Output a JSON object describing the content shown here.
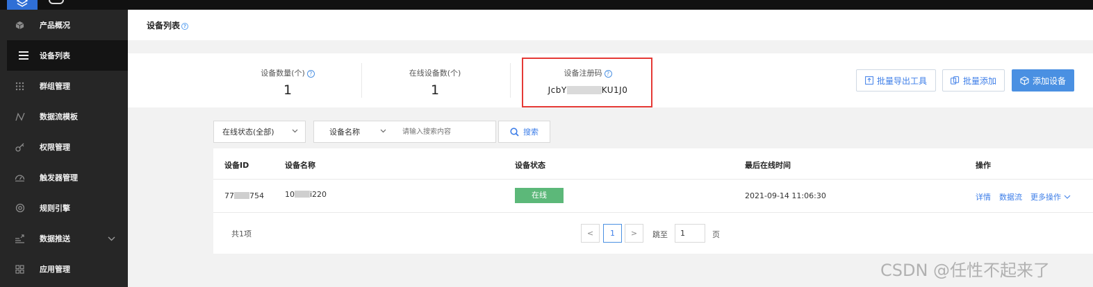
{
  "sidebar": {
    "items": [
      {
        "label": "产品概况",
        "icon": "cube-icon"
      },
      {
        "label": "设备列表",
        "icon": "list-icon"
      },
      {
        "label": "群组管理",
        "icon": "grid-dots-icon"
      },
      {
        "label": "数据流模板",
        "icon": "flow-icon"
      },
      {
        "label": "权限管理",
        "icon": "key-icon"
      },
      {
        "label": "触发器管理",
        "icon": "gauge-icon"
      },
      {
        "label": "规则引擎",
        "icon": "target-icon"
      },
      {
        "label": "数据推送",
        "icon": "push-icon"
      },
      {
        "label": "应用管理",
        "icon": "apps-icon"
      }
    ],
    "active_index": 1
  },
  "header": {
    "title": "设备列表"
  },
  "stats": {
    "device_count_label": "设备数量(个)",
    "device_count": "1",
    "online_count_label": "在线设备数(个)",
    "online_count": "1",
    "reg_code_label": "设备注册码",
    "reg_code_prefix": "JcbY",
    "reg_code_suffix": "KU1J0"
  },
  "actions": {
    "export": "批量导出工具",
    "batch_add": "批量添加",
    "add": "添加设备"
  },
  "filters": {
    "status_select": "在线状态(全部)",
    "field_select": "设备名称",
    "search_placeholder": "请输入搜索内容",
    "search_button": "搜索"
  },
  "table": {
    "headers": [
      "设备ID",
      "设备名称",
      "设备状态",
      "最后在线时间",
      "操作"
    ],
    "rows": [
      {
        "id_prefix": "77",
        "id_suffix": "754",
        "name_prefix": "10",
        "name_suffix": "i220",
        "status": "在线",
        "last_online": "2021-09-14 11:06:30",
        "ops": [
          "详情",
          "数据流",
          "更多操作"
        ]
      }
    ]
  },
  "pagination": {
    "total": "共1项",
    "current": "1",
    "prev": "<",
    "next": ">",
    "jump_label": "跳至",
    "jump_value": "1",
    "page_unit": "页"
  },
  "watermark": "CSDN @任性不起来了",
  "colors": {
    "primary": "#4a90e2",
    "online": "#5cb879",
    "highlight": "#e53935",
    "sidebar": "#262626"
  }
}
